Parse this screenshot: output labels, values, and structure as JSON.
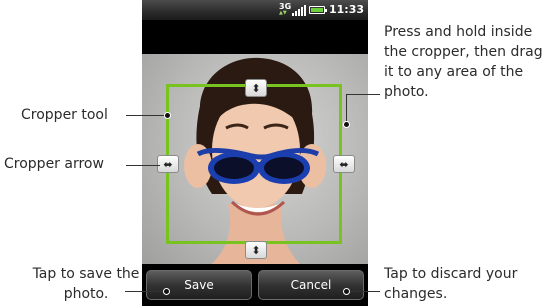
{
  "status_bar": {
    "network": "3G",
    "time": "11:33"
  },
  "buttons": {
    "save_label": "Save",
    "cancel_label": "Cancel"
  },
  "callouts": {
    "cropper_tool": "Cropper tool",
    "cropper_arrow": "Cropper arrow",
    "save_note": "Tap to save the photo.",
    "drag_note": "Press and hold inside the cropper, then drag it to any area of the photo.",
    "cancel_note": "Tap to discard your changes."
  },
  "colors": {
    "cropper_border": "#78c320",
    "battery": "#6ecf3c"
  },
  "icons": {
    "vertical_handle": "up-down-arrow-icon",
    "horizontal_handle": "left-right-arrow-icon"
  }
}
